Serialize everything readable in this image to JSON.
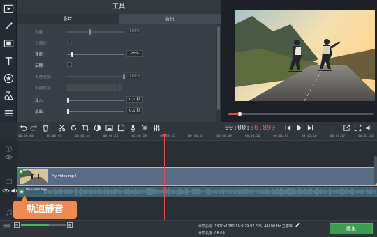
{
  "window": {
    "panel_title": "工具",
    "tabs": [
      "影片",
      "音訊"
    ]
  },
  "properties": {
    "rows": [
      {
        "label": "音量:",
        "value": "100%",
        "red": "0",
        "dim": true,
        "type": "slider",
        "level": 0.4
      },
      {
        "label": "正規化:",
        "dim": true,
        "type": "checkbox"
      },
      {
        "label": "速度:",
        "value": "25%",
        "dim": false,
        "type": "slider",
        "level": 0.07
      },
      {
        "label": "反轉:",
        "dim": false,
        "type": "checkbox"
      },
      {
        "label": "不透明度:",
        "value": "100%",
        "dim": true,
        "type": "slider",
        "level": 1.0
      },
      {
        "label": "填補顏色:",
        "dim": true,
        "type": "color"
      },
      {
        "label": "淡入:",
        "value": "0,0 秒",
        "dim": false,
        "type": "slider",
        "level": 0.0
      },
      {
        "label": "淡出:",
        "value": "0,0 秒",
        "dim": false,
        "type": "slider",
        "level": 0.0
      }
    ]
  },
  "player": {
    "timecode_grey": "00:00:",
    "timecode_red": "36.890",
    "progress": 0.08
  },
  "timeline": {
    "ticks": [
      "00:00:00",
      "00:00:07",
      "00:00:14",
      "00:00:21",
      "00:00:28",
      "00:00:35",
      "00:00:42",
      "00:00:49",
      "00:00:56",
      "00:01:03",
      "00:01:10",
      "00:01:17",
      "00:01:24"
    ],
    "video_clip_label": "My video.mp4",
    "audio_clip_label": "My video.mp4"
  },
  "callout": {
    "text": "軌道靜音"
  },
  "bottom": {
    "scale_label": "比例:",
    "project_settings_label": "專案設定:",
    "project_settings_value": "1920x1080 16:9 29.97 FPS, 44100 Hz 立體聲",
    "project_length_label": "專案長度:",
    "project_length_value": "08:09",
    "export_label": "匯出",
    "zoom_level": 0.62
  },
  "colors": {
    "accent_red": "#d95050",
    "export_green": "#3d9b4f",
    "callout_orange": "#ef8a52",
    "clip_border": "#e6b25a"
  }
}
